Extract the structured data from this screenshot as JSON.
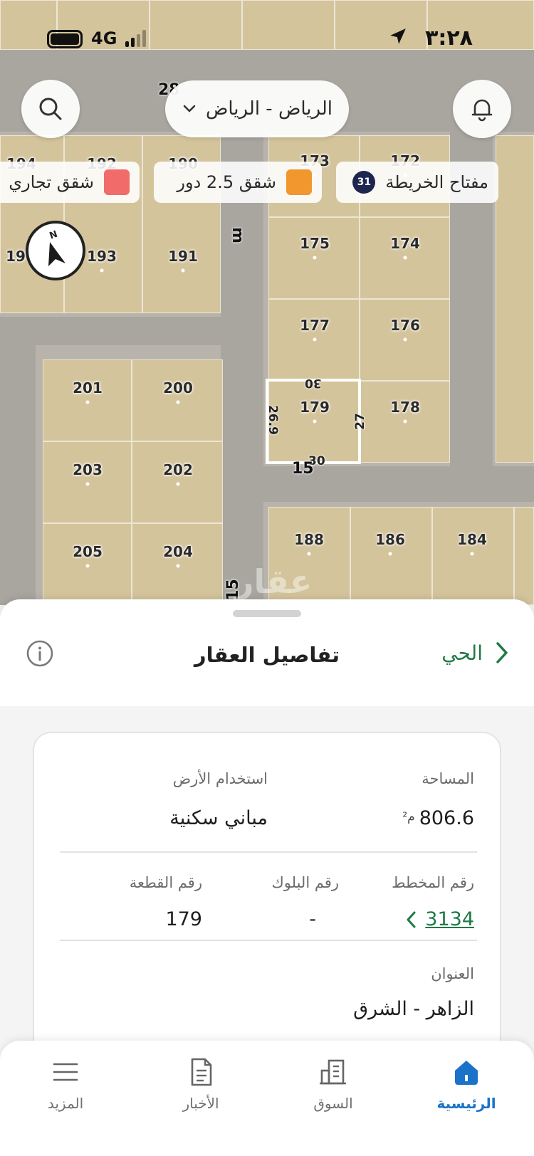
{
  "status_bar": {
    "time": "٣:٢٨",
    "network": "4G"
  },
  "map": {
    "city_selector": "الرياض - الرياض",
    "legend": [
      {
        "label": "مفتاح الخريطة",
        "badge": "31"
      },
      {
        "label": "شقق 2.5 دور",
        "color": "#f2962e"
      },
      {
        "label": "شقق تجاري",
        "color": "#f26b6b"
      }
    ],
    "plots": [
      "194",
      "192",
      "190",
      "173",
      "172",
      "19",
      "193",
      "191",
      "175",
      "174",
      "177",
      "176",
      "201",
      "200",
      "179",
      "178",
      "203",
      "202",
      "205",
      "204",
      "188",
      "186",
      "184"
    ],
    "street_labels": [
      "28",
      "m",
      "15",
      "15"
    ],
    "dimensions": {
      "top": "30",
      "left": "26.9",
      "right": "27",
      "bottom": "30"
    },
    "watermark": "عقار"
  },
  "sheet": {
    "title": "تفاصيل العقار",
    "back_label": "الحي",
    "fields": {
      "area_label": "المساحة",
      "area_value": "806.6",
      "area_unit": "م²",
      "land_use_label": "استخدام الأرض",
      "land_use_value": "مباني سكنية",
      "plan_label": "رقم المخطط",
      "plan_value": "3134",
      "block_label": "رقم البلوك",
      "block_value": "-",
      "parcel_label": "رقم القطعة",
      "parcel_value": "179",
      "address_label": "العنوان",
      "address_value": "الزاهر - الشرق"
    }
  },
  "tabbar": {
    "items": [
      {
        "label": "الرئيسية",
        "icon": "home-icon",
        "active": true
      },
      {
        "label": "السوق",
        "icon": "buildings-icon"
      },
      {
        "label": "الأخبار",
        "icon": "news-icon"
      },
      {
        "label": "المزيد",
        "icon": "menu-icon"
      }
    ]
  },
  "colors": {
    "accent_green": "#1f7a45",
    "active_blue": "#1a73c8"
  }
}
